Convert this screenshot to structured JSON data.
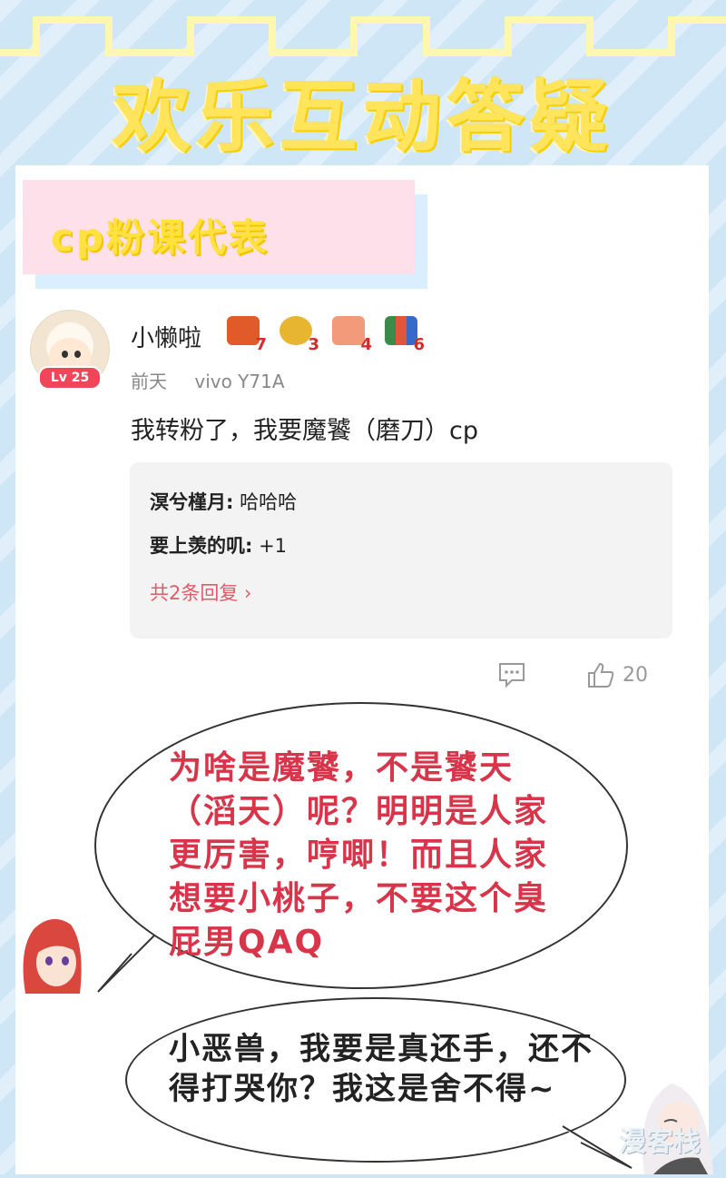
{
  "header": {
    "title": "欢乐互动答疑"
  },
  "section": {
    "badge": "cp粉课代表"
  },
  "comment": {
    "avatar_level": "Lv 25",
    "username": "小懒啦",
    "medals": [
      {
        "icon": "gift-box-icon",
        "count": "7",
        "color": "#e05a2a"
      },
      {
        "icon": "trophy-icon",
        "count": "3",
        "color": "#e8b530"
      },
      {
        "icon": "thumb-badge-icon",
        "count": "4",
        "color": "#f29a7a"
      },
      {
        "icon": "books-icon",
        "count": "6",
        "color": "#3a8a4a"
      }
    ],
    "time": "前天",
    "device": "vivo Y71A",
    "text": "我转粉了，我要魔饕（磨刀）cp",
    "replies": [
      {
        "author": "溟兮槿月:",
        "text": " 哈哈哈"
      },
      {
        "author": "要上羡的叽:",
        "text": " +1"
      }
    ],
    "more_replies": "共2条回复 ›",
    "like_count": "20"
  },
  "bubble_1": {
    "text": "为啥是魔饕，不是饕天（滔天）呢？明明是人家更厉害，哼唧！而且人家想要小桃子，不要这个臭屁男QAQ"
  },
  "bubble_2": {
    "text": "小恶兽，我要是真还手，还不得打哭你？我这是舍不得~"
  },
  "watermark": "漫客栈"
}
